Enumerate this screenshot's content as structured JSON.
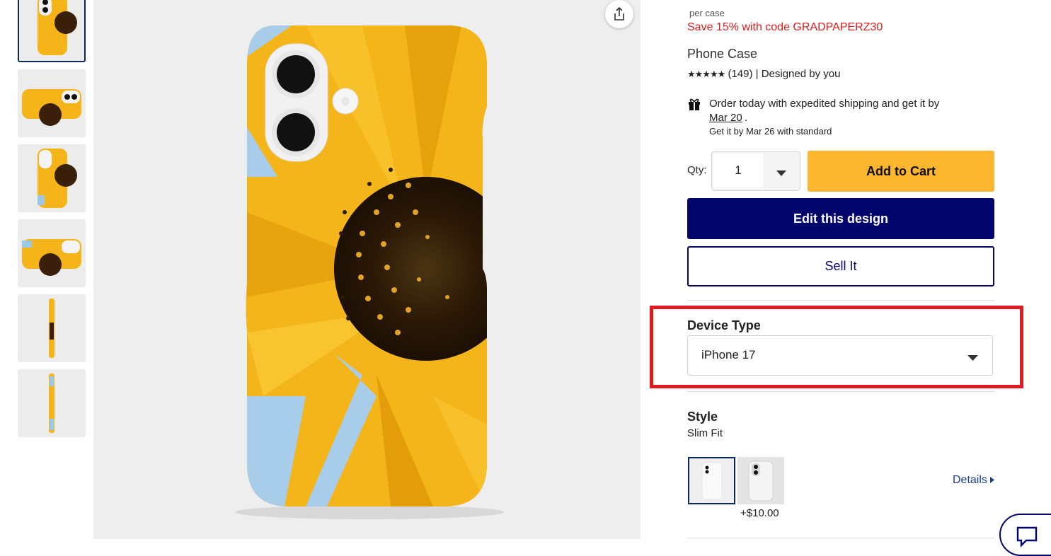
{
  "thumbnails": [
    {
      "name": "thumb-front"
    },
    {
      "name": "thumb-back-landscape"
    },
    {
      "name": "thumb-front-2"
    },
    {
      "name": "thumb-landscape-2"
    },
    {
      "name": "thumb-side-1"
    },
    {
      "name": "thumb-side-2"
    }
  ],
  "product": {
    "per_case": "per case",
    "promo": "Save 15% with code GRADPAPERZ30",
    "title": "Phone Case",
    "stars": "★★★★★",
    "rating_text": "(149) | Designed by you",
    "shipping_line1": "Order today with expedited shipping and get it by",
    "shipping_date": "Mar 20",
    "shipping_period": ".",
    "shipping_line3": "Get it by Mar 26 with standard"
  },
  "purchase": {
    "qty_label": "Qty:",
    "qty_value": "1",
    "add_to_cart": "Add to Cart",
    "edit_design": "Edit this design",
    "sell_it": "Sell It"
  },
  "device": {
    "label": "Device Type",
    "selected": "iPhone 17"
  },
  "style": {
    "label": "Style",
    "selected": "Slim Fit",
    "option2_price": "+$10.00",
    "details_link": "Details"
  },
  "colors": {
    "navy": "#02056b",
    "cart_yellow": "#fdb62f",
    "promo_red": "#e01c1c",
    "highlight_red": "#e01b22",
    "link_blue": "#1c3d8c"
  },
  "icons": [
    "gift-icon",
    "share-icon",
    "chevron-down-icon",
    "caret-right-icon",
    "chat-icon"
  ]
}
